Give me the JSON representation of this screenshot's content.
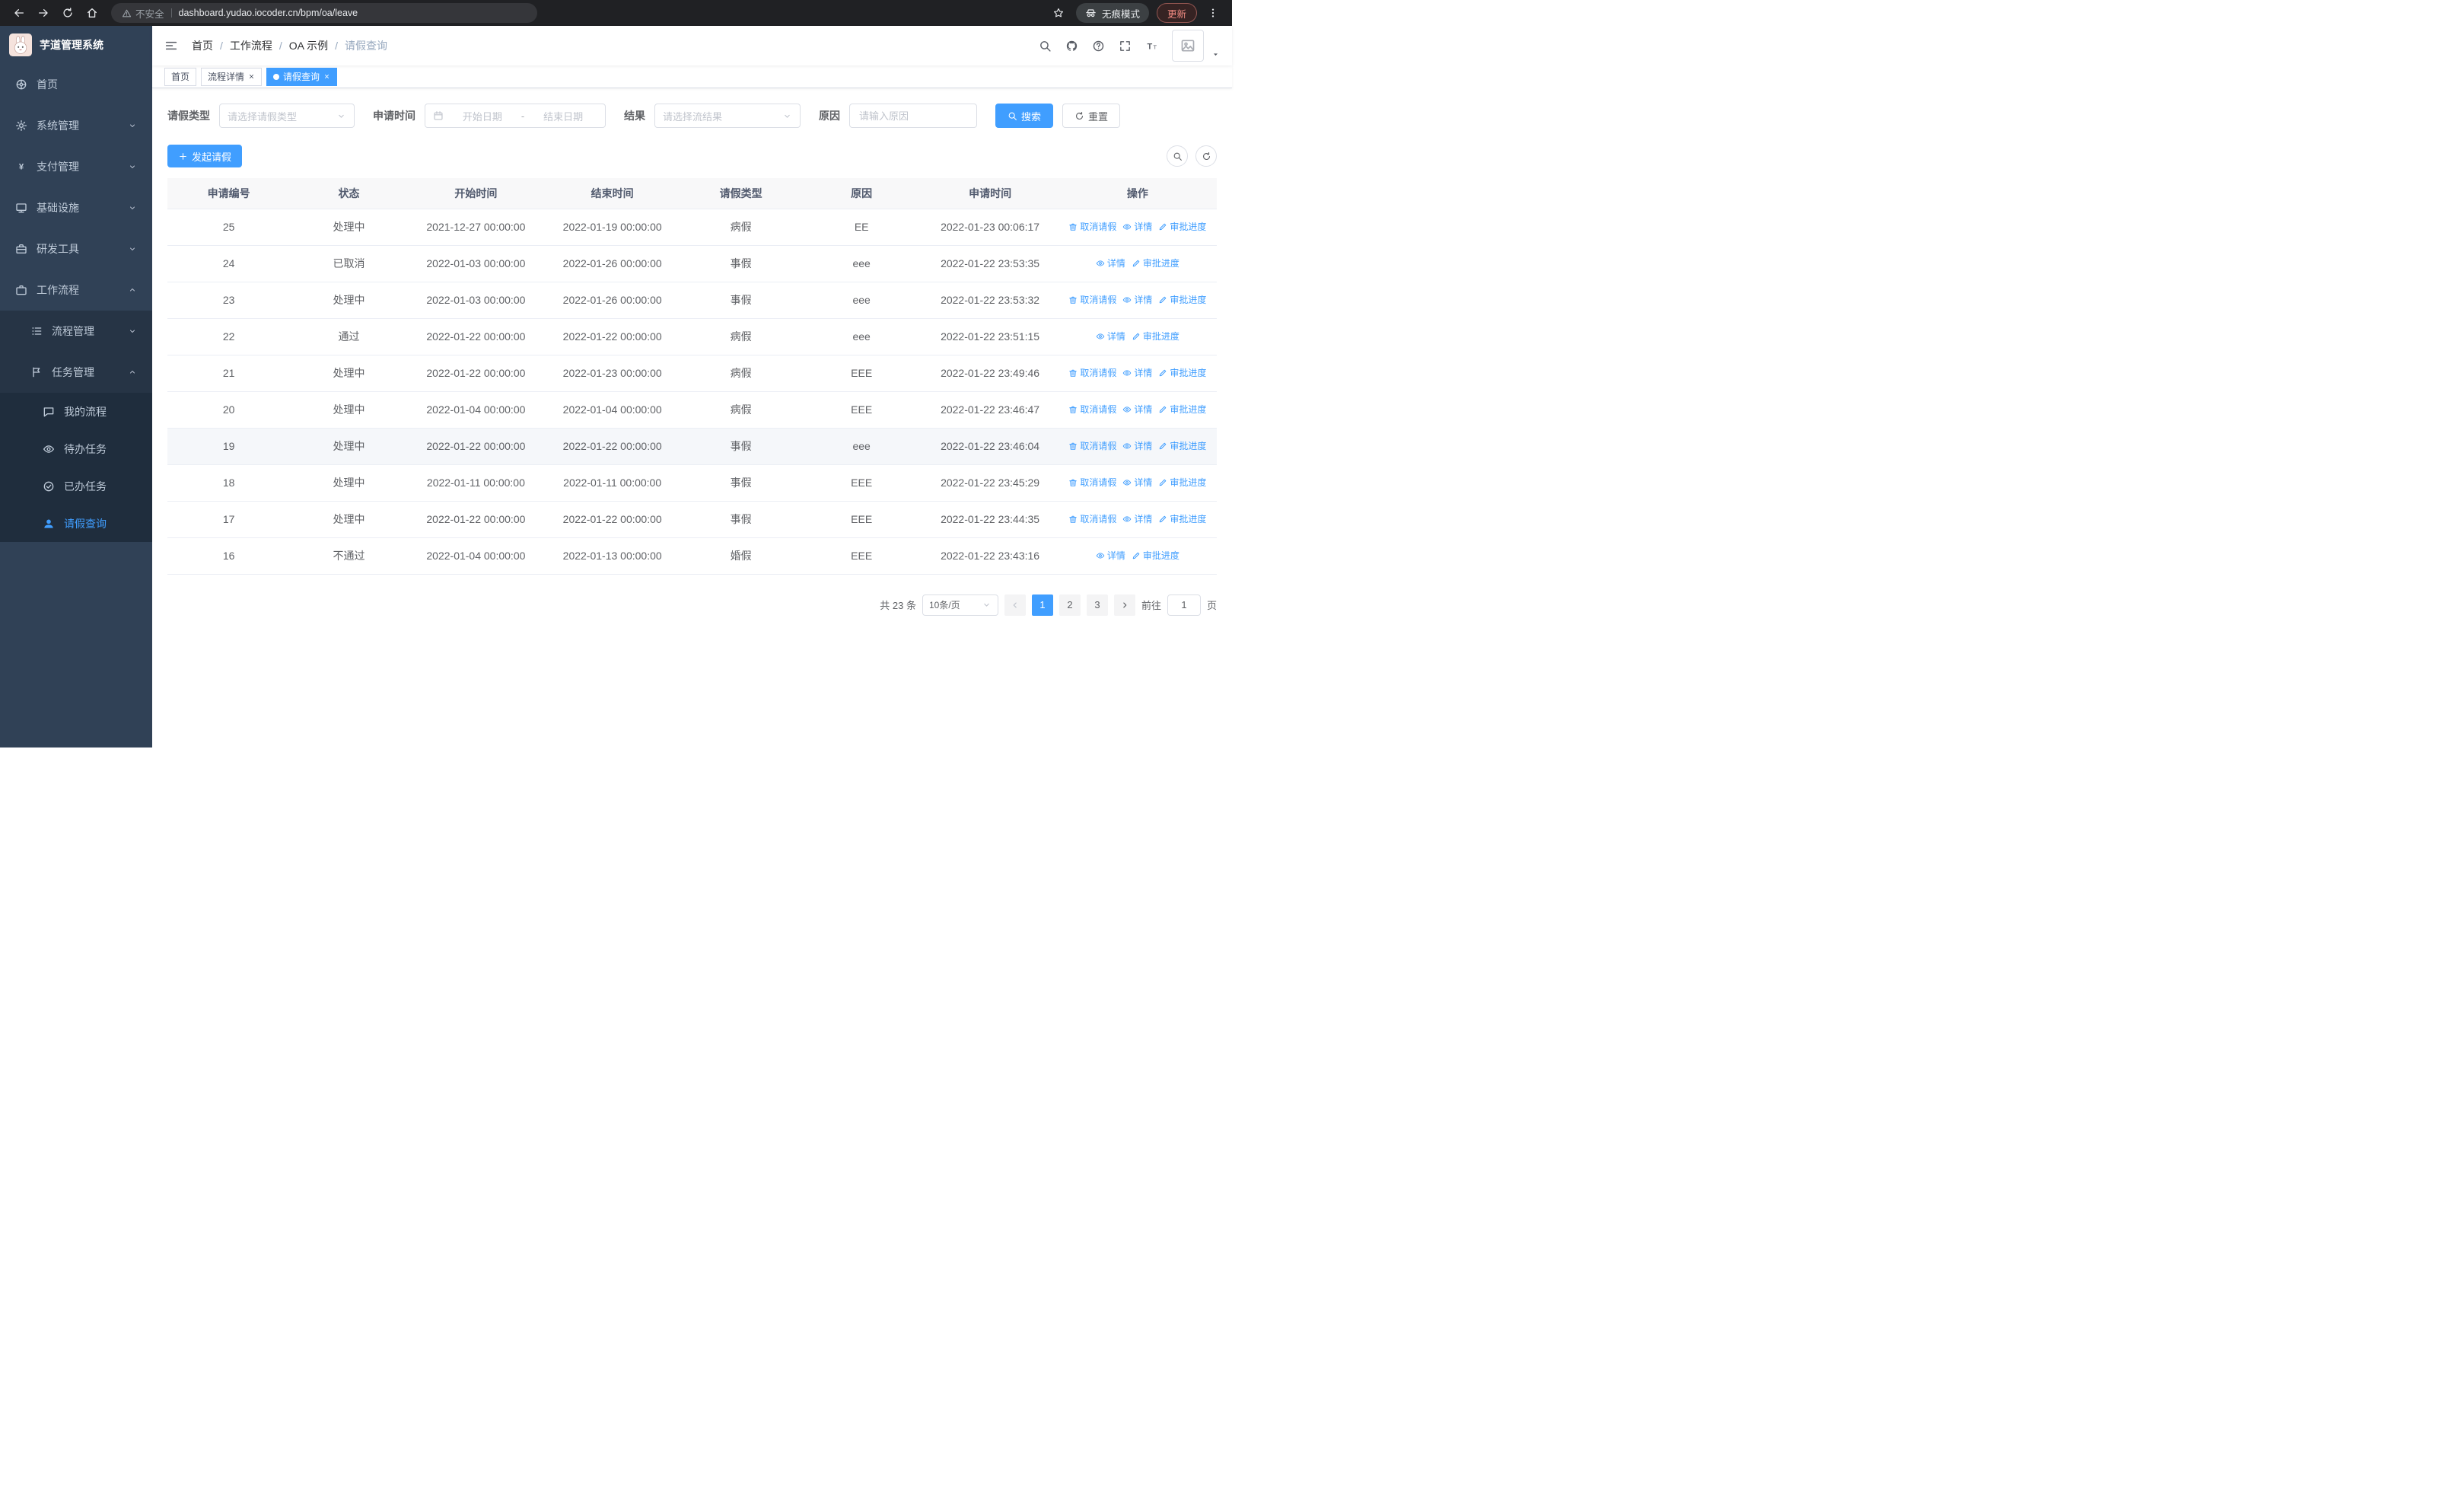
{
  "browser": {
    "warning_text": "不安全",
    "url": "dashboard.yudao.iocoder.cn/bpm/oa/leave",
    "incognito_text": "无痕模式",
    "update_text": "更新"
  },
  "sidebar": {
    "logo_title": "芋道管理系统",
    "menu": [
      {
        "id": "home",
        "label": "首页",
        "icon": "dashboard"
      },
      {
        "id": "system-mgmt",
        "label": "系统管理",
        "icon": "gear",
        "arrow": "down"
      },
      {
        "id": "payment-mgmt",
        "label": "支付管理",
        "icon": "yen",
        "arrow": "down"
      },
      {
        "id": "infrastructure",
        "label": "基础设施",
        "icon": "monitor",
        "arrow": "down"
      },
      {
        "id": "dev-tools",
        "label": "研发工具",
        "icon": "toolbox",
        "arrow": "down"
      },
      {
        "id": "workflow",
        "label": "工作流程",
        "icon": "briefcase",
        "arrow": "up",
        "children": [
          {
            "id": "process-mgmt",
            "label": "流程管理",
            "icon": "list",
            "arrow": "down"
          },
          {
            "id": "task-mgmt",
            "label": "任务管理",
            "icon": "flag",
            "arrow": "up",
            "children": [
              {
                "id": "my-process",
                "label": "我的流程",
                "icon": "chat"
              },
              {
                "id": "todo-tasks",
                "label": "待办任务",
                "icon": "eye"
              },
              {
                "id": "done-tasks",
                "label": "已办任务",
                "icon": "check-circle"
              },
              {
                "id": "leave-query",
                "label": "请假查询",
                "icon": "user",
                "active": true
              }
            ]
          }
        ]
      }
    ]
  },
  "header": {
    "breadcrumb": [
      "首页",
      "工作流程",
      "OA 示例",
      "请假查询"
    ]
  },
  "tabs": [
    {
      "id": "home",
      "label": "首页",
      "closable": false,
      "active": false
    },
    {
      "id": "process-detail",
      "label": "流程详情",
      "closable": true,
      "active": false
    },
    {
      "id": "leave-query",
      "label": "请假查询",
      "closable": true,
      "active": true
    }
  ],
  "filters": {
    "leave_type_label": "请假类型",
    "leave_type_placeholder": "请选择请假类型",
    "apply_time_label": "申请时间",
    "start_date_placeholder": "开始日期",
    "range_separator": "-",
    "end_date_placeholder": "结束日期",
    "result_label": "结果",
    "result_placeholder": "请选择流结果",
    "reason_label": "原因",
    "reason_placeholder": "请输入原因",
    "search_button": "搜索",
    "reset_button": "重置"
  },
  "toolbar": {
    "create_label": "发起请假"
  },
  "table": {
    "columns": [
      "申请编号",
      "状态",
      "开始时间",
      "结束时间",
      "请假类型",
      "原因",
      "申请时间",
      "操作"
    ],
    "action_defs": {
      "cancel": {
        "label": "取消请假",
        "icon": "delete"
      },
      "detail": {
        "label": "详情",
        "icon": "eye"
      },
      "progress": {
        "label": "审批进度",
        "icon": "edit"
      }
    },
    "rows": [
      {
        "id": "25",
        "status": "处理中",
        "start": "2021-12-27 00:00:00",
        "end": "2022-01-19 00:00:00",
        "type": "病假",
        "reason": "EE",
        "applied": "2022-01-23 00:06:17",
        "actions": [
          "cancel",
          "detail",
          "progress"
        ],
        "highlight": false
      },
      {
        "id": "24",
        "status": "已取消",
        "start": "2022-01-03 00:00:00",
        "end": "2022-01-26 00:00:00",
        "type": "事假",
        "reason": "eee",
        "applied": "2022-01-22 23:53:35",
        "actions": [
          "detail",
          "progress"
        ],
        "highlight": false
      },
      {
        "id": "23",
        "status": "处理中",
        "start": "2022-01-03 00:00:00",
        "end": "2022-01-26 00:00:00",
        "type": "事假",
        "reason": "eee",
        "applied": "2022-01-22 23:53:32",
        "actions": [
          "cancel",
          "detail",
          "progress"
        ],
        "highlight": false
      },
      {
        "id": "22",
        "status": "通过",
        "start": "2022-01-22 00:00:00",
        "end": "2022-01-22 00:00:00",
        "type": "病假",
        "reason": "eee",
        "applied": "2022-01-22 23:51:15",
        "actions": [
          "detail",
          "progress"
        ],
        "highlight": false
      },
      {
        "id": "21",
        "status": "处理中",
        "start": "2022-01-22 00:00:00",
        "end": "2022-01-23 00:00:00",
        "type": "病假",
        "reason": "EEE",
        "applied": "2022-01-22 23:49:46",
        "actions": [
          "cancel",
          "detail",
          "progress"
        ],
        "highlight": false
      },
      {
        "id": "20",
        "status": "处理中",
        "start": "2022-01-04 00:00:00",
        "end": "2022-01-04 00:00:00",
        "type": "病假",
        "reason": "EEE",
        "applied": "2022-01-22 23:46:47",
        "actions": [
          "cancel",
          "detail",
          "progress"
        ],
        "highlight": false
      },
      {
        "id": "19",
        "status": "处理中",
        "start": "2022-01-22 00:00:00",
        "end": "2022-01-22 00:00:00",
        "type": "事假",
        "reason": "eee",
        "applied": "2022-01-22 23:46:04",
        "actions": [
          "cancel",
          "detail",
          "progress"
        ],
        "highlight": true
      },
      {
        "id": "18",
        "status": "处理中",
        "start": "2022-01-11 00:00:00",
        "end": "2022-01-11 00:00:00",
        "type": "事假",
        "reason": "EEE",
        "applied": "2022-01-22 23:45:29",
        "actions": [
          "cancel",
          "detail",
          "progress"
        ],
        "highlight": false
      },
      {
        "id": "17",
        "status": "处理中",
        "start": "2022-01-22 00:00:00",
        "end": "2022-01-22 00:00:00",
        "type": "事假",
        "reason": "EEE",
        "applied": "2022-01-22 23:44:35",
        "actions": [
          "cancel",
          "detail",
          "progress"
        ],
        "highlight": false
      },
      {
        "id": "16",
        "status": "不通过",
        "start": "2022-01-04 00:00:00",
        "end": "2022-01-13 00:00:00",
        "type": "婚假",
        "reason": "EEE",
        "applied": "2022-01-22 23:43:16",
        "actions": [
          "detail",
          "progress"
        ],
        "highlight": false
      }
    ]
  },
  "pagination": {
    "total_text": "共 23 条",
    "page_size": "10条/页",
    "pages": [
      "1",
      "2",
      "3"
    ],
    "active_page": "1",
    "goto_label": "前往",
    "goto_value": "1",
    "unit_label": "页"
  },
  "colors": {
    "primary": "#409eff",
    "sidebar_bg": "#304156",
    "sidebar_submenu_bg": "#1f2d3d",
    "chrome_bg": "#202124",
    "table_border": "#ebeef5"
  }
}
